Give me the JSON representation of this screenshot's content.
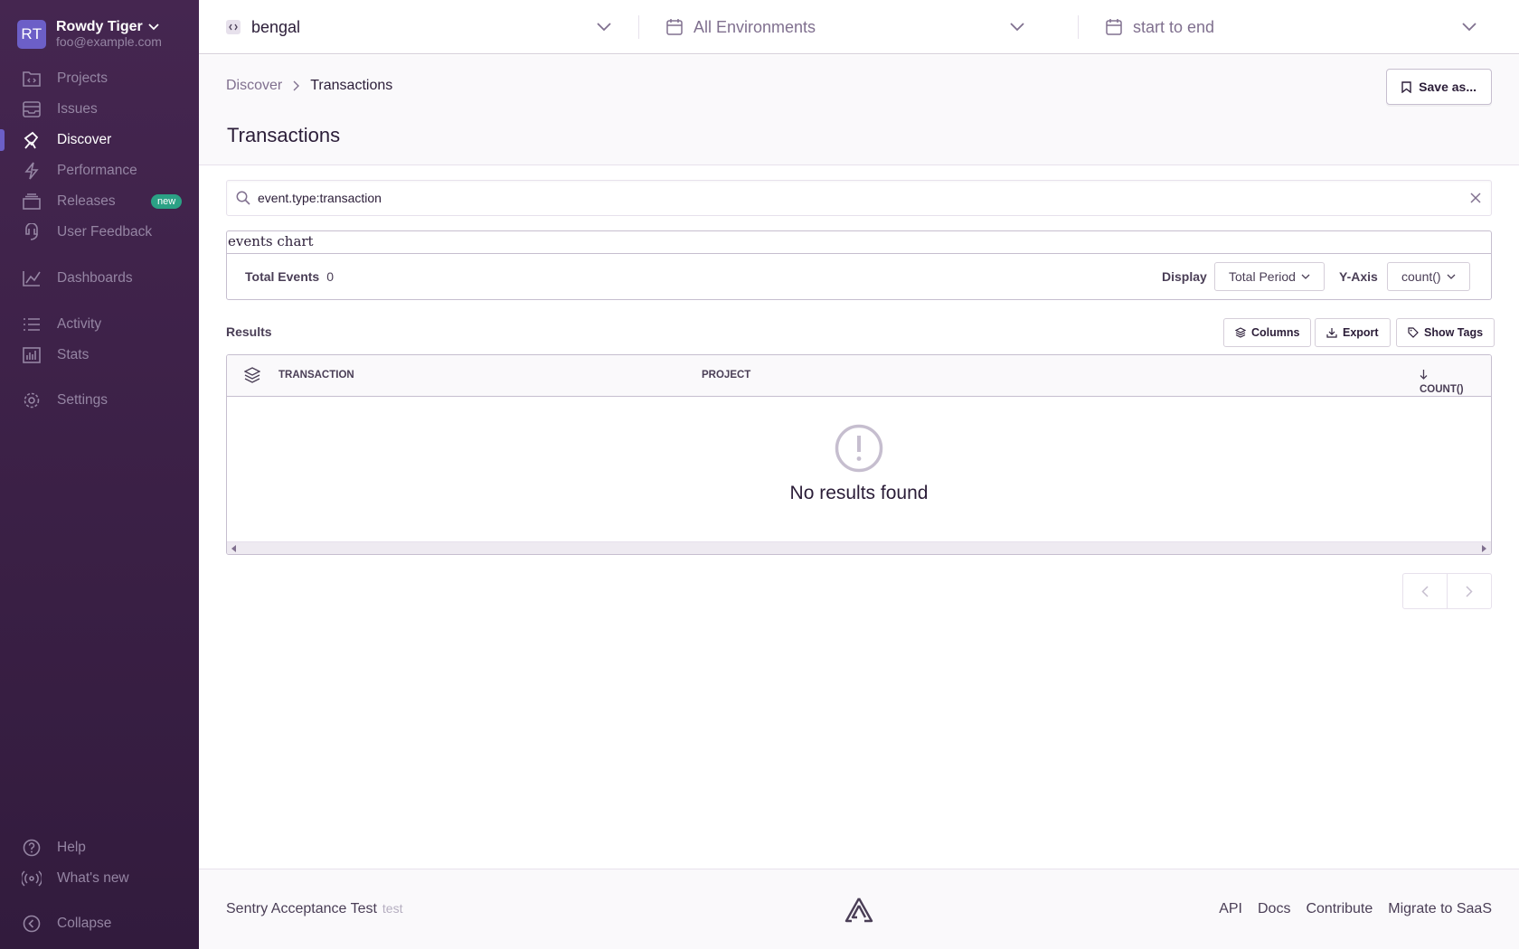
{
  "org": {
    "initials": "RT",
    "name": "Rowdy Tiger",
    "email": "foo@example.com"
  },
  "nav": {
    "projects": "Projects",
    "issues": "Issues",
    "discover": "Discover",
    "performance": "Performance",
    "releases": "Releases",
    "releases_badge": "new",
    "user_feedback": "User Feedback",
    "dashboards": "Dashboards",
    "activity": "Activity",
    "stats": "Stats",
    "settings": "Settings",
    "help": "Help",
    "whats_new": "What's new",
    "collapse": "Collapse"
  },
  "topbar": {
    "project": "bengal",
    "environment": "All Environments",
    "time": "start to end"
  },
  "header": {
    "crumb_parent": "Discover",
    "crumb_current": "Transactions",
    "title": "Transactions",
    "save_label": "Save as..."
  },
  "search": {
    "query": "event.type:transaction"
  },
  "chart": {
    "title": "events chart",
    "total_label": "Total Events",
    "total_value": "0",
    "display_label": "Display",
    "display_value": "Total Period",
    "yaxis_label": "Y-Axis",
    "yaxis_value": "count()"
  },
  "results": {
    "label": "Results",
    "columns_btn": "Columns",
    "export_btn": "Export",
    "tags_btn": "Show Tags"
  },
  "table": {
    "columns": [
      "Transaction",
      "Project",
      "count()"
    ],
    "empty": "No results found"
  },
  "footer": {
    "name": "Sentry Acceptance Test",
    "version": "test",
    "links": [
      "API",
      "Docs",
      "Contribute",
      "Migrate to SaaS"
    ]
  },
  "colors": {
    "sidebar": "#452650",
    "accent": "#6c5fc7",
    "badge": "#2ba185"
  }
}
